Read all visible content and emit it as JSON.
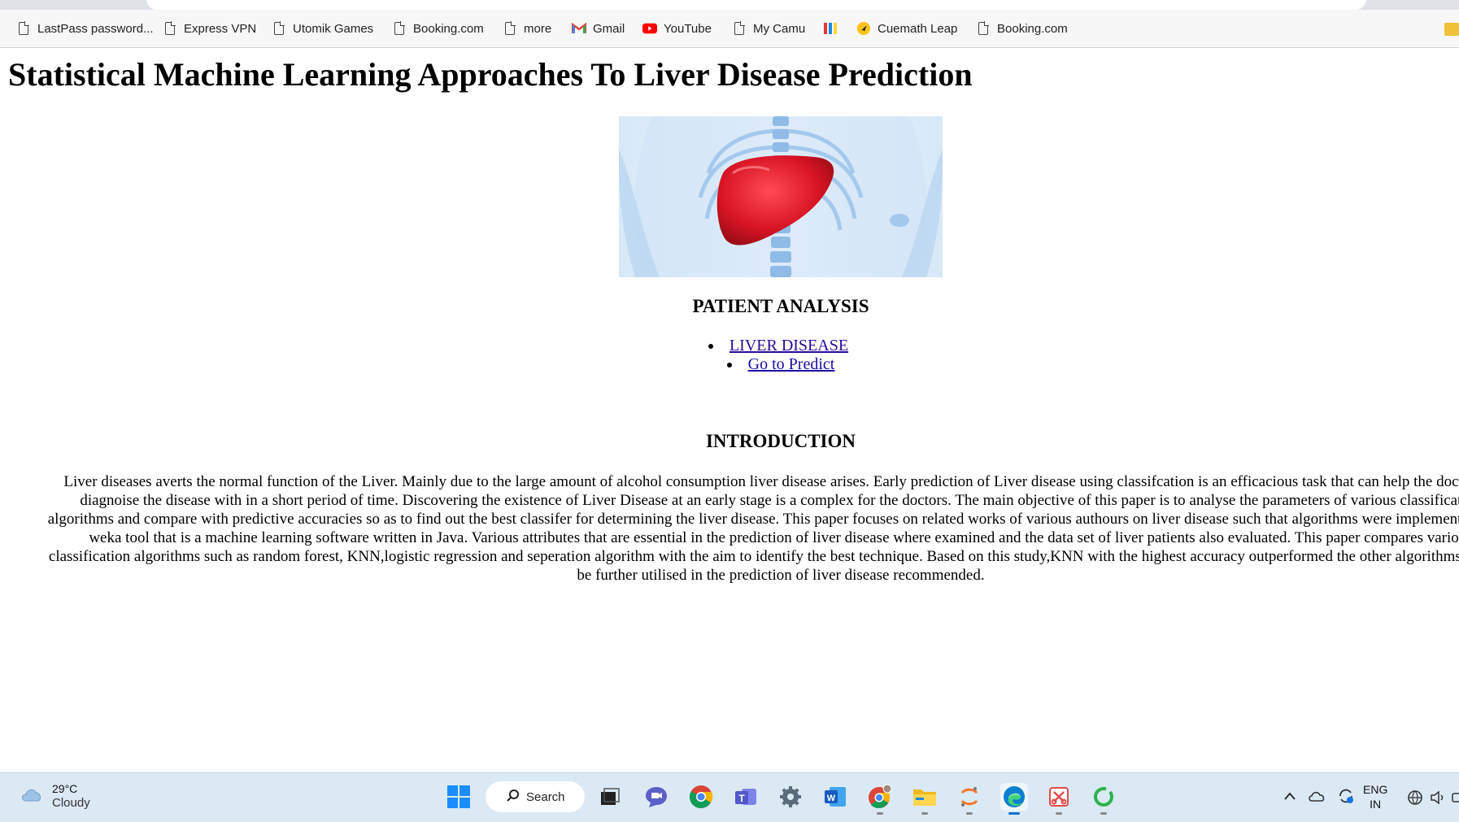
{
  "bookmarks": [
    {
      "label": "LastPass password...",
      "icon": "document-icon"
    },
    {
      "label": "Express VPN",
      "icon": "document-icon"
    },
    {
      "label": "Utomik Games",
      "icon": "document-icon"
    },
    {
      "label": "Booking.com",
      "icon": "document-icon"
    },
    {
      "label": "more",
      "icon": "document-icon"
    },
    {
      "label": "Gmail",
      "icon": "gmail-icon"
    },
    {
      "label": "YouTube",
      "icon": "youtube-icon"
    },
    {
      "label": "My Camu",
      "icon": "document-icon"
    },
    {
      "label": "",
      "icon": "colored-bars-icon"
    },
    {
      "label": "Cuemath Leap",
      "icon": "cuemath-icon"
    },
    {
      "label": "Booking.com",
      "icon": "document-icon"
    }
  ],
  "page": {
    "title": "Statistical Machine Learning Approaches To Liver Disease Prediction",
    "patient_heading": "PATIENT ANALYSIS",
    "links": [
      "LIVER DISEASE",
      "Go to Predict"
    ],
    "intro_heading": "INTRODUCTION",
    "intro_lines": [
      "Liver diseases averts the normal function of the Liver. Mainly due to the large amount of alcohol consumption liver disease arises. Early prediction of Liver disease using classifcation is an efficacious task that can help the doctors to",
      "diagnoise the disease with in a short period of time. Discovering the existence of Liver Disease at an early stage is a complex for the doctors. The main objective of this paper is to analyse the parameters of various classification",
      "algorithms and compare with predictive accuracies so as to find out the best classifer for determining the liver disease. This paper focuses on related works of various authours on liver disease such that algorithms were implemented using",
      "weka tool that is a machine learning software written in Java. Various attributes that are essential in the prediction of liver disease where examined and the data set of liver patients also evaluated. This paper compares various",
      "classification algorithms such as random forest, KNN,logistic regression and seperation algorithm with the aim to identify the best technique. Based on this study,KNN with the highest accuracy outperformed the other algorithms and can",
      "be further utilised in the prediction of liver disease recommended."
    ]
  },
  "taskbar": {
    "weather_temp": "29°C",
    "weather_condition": "Cloudy",
    "search_label": "Search",
    "language": "ENG",
    "region": "IN"
  }
}
